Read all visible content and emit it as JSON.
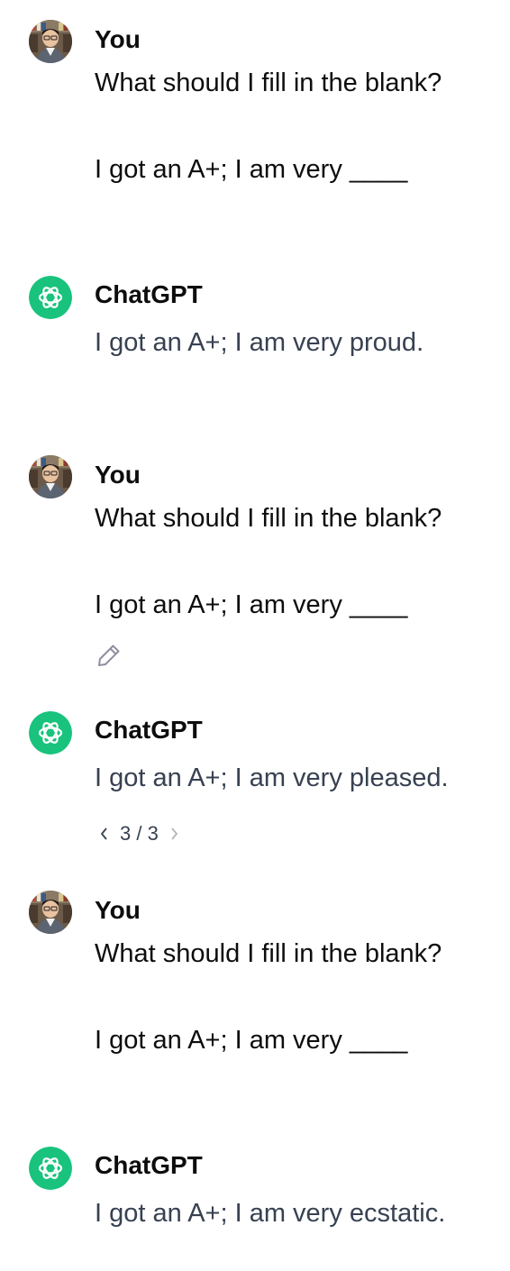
{
  "colors": {
    "assistant_avatar_bg": "#19c37d",
    "user_text": "#0d0d0d",
    "assistant_text": "#374151"
  },
  "messages": [
    {
      "author": "You",
      "lines": [
        "What should I fill in the blank?",
        "I got an A+; I am very ____"
      ]
    },
    {
      "author": "ChatGPT",
      "lines": [
        "I got an A+; I am very proud."
      ]
    },
    {
      "author": "You",
      "lines": [
        "What should I fill in the blank?",
        "I got an A+; I am very ____"
      ]
    },
    {
      "author": "ChatGPT",
      "lines": [
        "I got an A+; I am very pleased."
      ],
      "pager": {
        "current": 3,
        "total": 3,
        "label": "3 / 3"
      }
    },
    {
      "author": "You",
      "lines": [
        "What should I fill in the blank?",
        "I got an A+; I am very ____"
      ]
    },
    {
      "author": "ChatGPT",
      "lines": [
        "I got an A+; I am very ecstatic."
      ]
    }
  ],
  "icons": {
    "user_avatar": "user-avatar-photo",
    "assistant_avatar": "openai-logo-icon",
    "edit": "pencil-icon",
    "prev": "chevron-left-icon",
    "next": "chevron-right-icon"
  }
}
